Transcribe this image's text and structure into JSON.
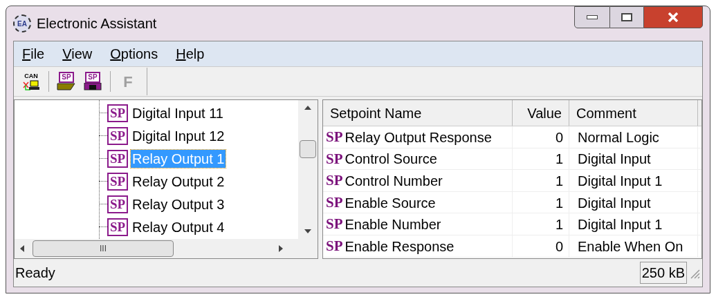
{
  "window": {
    "title": "Electronic Assistant",
    "app_icon_label": "EA"
  },
  "menu": [
    {
      "label": "File"
    },
    {
      "label": "View"
    },
    {
      "label": "Options"
    },
    {
      "label": "Help"
    }
  ],
  "toolbar": [
    {
      "kind": "can",
      "label": "CAN"
    },
    {
      "kind": "open",
      "label": "SP"
    },
    {
      "kind": "save",
      "label": "SP"
    },
    {
      "kind": "text",
      "label": "F",
      "disabled": true
    }
  ],
  "tree": {
    "items": [
      {
        "icon_label": "SP",
        "label": "Digital Input 11",
        "selected": false
      },
      {
        "icon_label": "SP",
        "label": "Digital Input 12",
        "selected": false
      },
      {
        "icon_label": "SP",
        "label": "Relay Output 1",
        "selected": true
      },
      {
        "icon_label": "SP",
        "label": "Relay Output 2",
        "selected": false
      },
      {
        "icon_label": "SP",
        "label": "Relay Output 3",
        "selected": false
      },
      {
        "icon_label": "SP",
        "label": "Relay Output 4",
        "selected": false
      }
    ],
    "hscroll_thumb": "III"
  },
  "table": {
    "columns": [
      "Setpoint Name",
      "Value",
      "Comment"
    ],
    "rows": [
      {
        "icon_label": "SP",
        "name": "Relay Output Response",
        "value": "0",
        "comment": "Normal Logic"
      },
      {
        "icon_label": "SP",
        "name": "Control Source",
        "value": "1",
        "comment": "Digital Input"
      },
      {
        "icon_label": "SP",
        "name": "Control Number",
        "value": "1",
        "comment": "Digital Input 1"
      },
      {
        "icon_label": "SP",
        "name": "Enable Source",
        "value": "1",
        "comment": "Digital Input"
      },
      {
        "icon_label": "SP",
        "name": "Enable Number",
        "value": "1",
        "comment": "Digital Input 1"
      },
      {
        "icon_label": "SP",
        "name": "Enable Response",
        "value": "0",
        "comment": "Enable When On"
      }
    ]
  },
  "status_bar": {
    "message": "Ready",
    "size": "250 kB"
  }
}
